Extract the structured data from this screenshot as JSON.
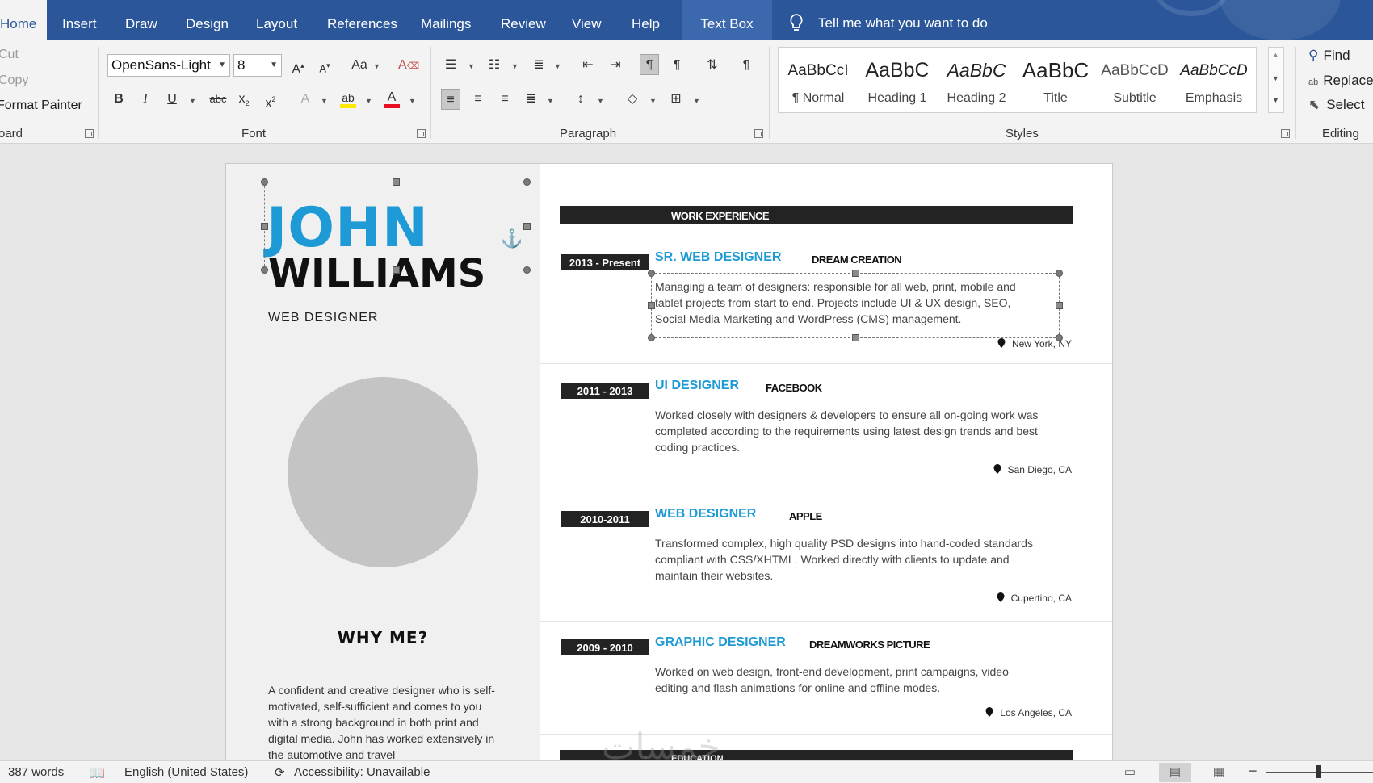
{
  "tabs": [
    {
      "label": "Home",
      "active": true
    },
    {
      "label": "Insert"
    },
    {
      "label": "Draw"
    },
    {
      "label": "Design"
    },
    {
      "label": "Layout"
    },
    {
      "label": "References"
    },
    {
      "label": "Mailings"
    },
    {
      "label": "Review"
    },
    {
      "label": "View"
    },
    {
      "label": "Help"
    },
    {
      "label": "Text Box",
      "contextual": true
    }
  ],
  "tell_me": "Tell me what you want to do",
  "ribbon": {
    "clipboard": {
      "cut": "Cut",
      "copy": "Copy",
      "format_painter": "Format Painter",
      "group_label": "oard"
    },
    "font": {
      "name": "OpenSans-Light",
      "size": "8",
      "group_label": "Font"
    },
    "paragraph": {
      "group_label": "Paragraph"
    },
    "styles": {
      "group_label": "Styles",
      "items": [
        {
          "sample": "AaBbCcI",
          "name": "¶ Normal"
        },
        {
          "sample": "AaBbC",
          "name": "Heading 1"
        },
        {
          "sample": "AaBbC",
          "name": "Heading 2"
        },
        {
          "sample": "AaBbC",
          "name": "Title"
        },
        {
          "sample": "AaBbCcD",
          "name": "Subtitle"
        },
        {
          "sample": "AaBbCcD",
          "name": "Emphasis"
        }
      ]
    },
    "editing": {
      "find": "Find",
      "replace": "Replace",
      "select": "Select",
      "group_label": "Editing"
    }
  },
  "resume": {
    "first_name": "JOHN",
    "last_name": "WILLIAMS",
    "role": "WEB DESIGNER",
    "why_title": "WHY ME?",
    "why_text": "A confident and creative designer who is self-motivated, self-sufficient and comes to you with a strong background in both print and digital media. John has worked extensively in the automotive and travel",
    "work_heading": "WORK EXPERIENCE",
    "education_heading": "EDUCATION",
    "jobs": [
      {
        "dates": "2013 - Present",
        "title": "SR. WEB DESIGNER",
        "company": "DREAM CREATION",
        "description": "Managing a team of designers: responsible for all web, print, mobile and tablet projects from start to end. Projects include UI & UX design, SEO, Social Media Marketing and WordPress (CMS) management.",
        "location": "New York, NY"
      },
      {
        "dates": "2011 - 2013",
        "title": "UI DESIGNER",
        "company": "FACEBOOK",
        "description": "Worked closely with designers & developers to ensure all on-going work was completed according to the requirements using latest design trends and best coding practices.",
        "location": "San Diego, CA"
      },
      {
        "dates": "2010-2011",
        "title": "WEB DESIGNER",
        "company": "APPLE",
        "description": "Transformed complex, high quality PSD designs into hand-coded standards compliant with CSS/XHTML. Worked directly with clients to update and maintain their websites.",
        "location": "Cupertino, CA"
      },
      {
        "dates": "2009 - 2010",
        "title": "GRAPHIC DESIGNER",
        "company": "DREAMWORKS PICTURE",
        "description": "Worked on web design, front-end development, print campaigns, video editing and flash animations for online and offline modes.",
        "location": "Los Angeles, CA"
      }
    ]
  },
  "status": {
    "words": "387 words",
    "language": "English (United States)",
    "accessibility": "Accessibility: Unavailable"
  },
  "watermark": "خمسات",
  "colors": {
    "ribbon_blue": "#2b579a",
    "accent": "#1e9ad6",
    "dark_bar": "#232323"
  }
}
